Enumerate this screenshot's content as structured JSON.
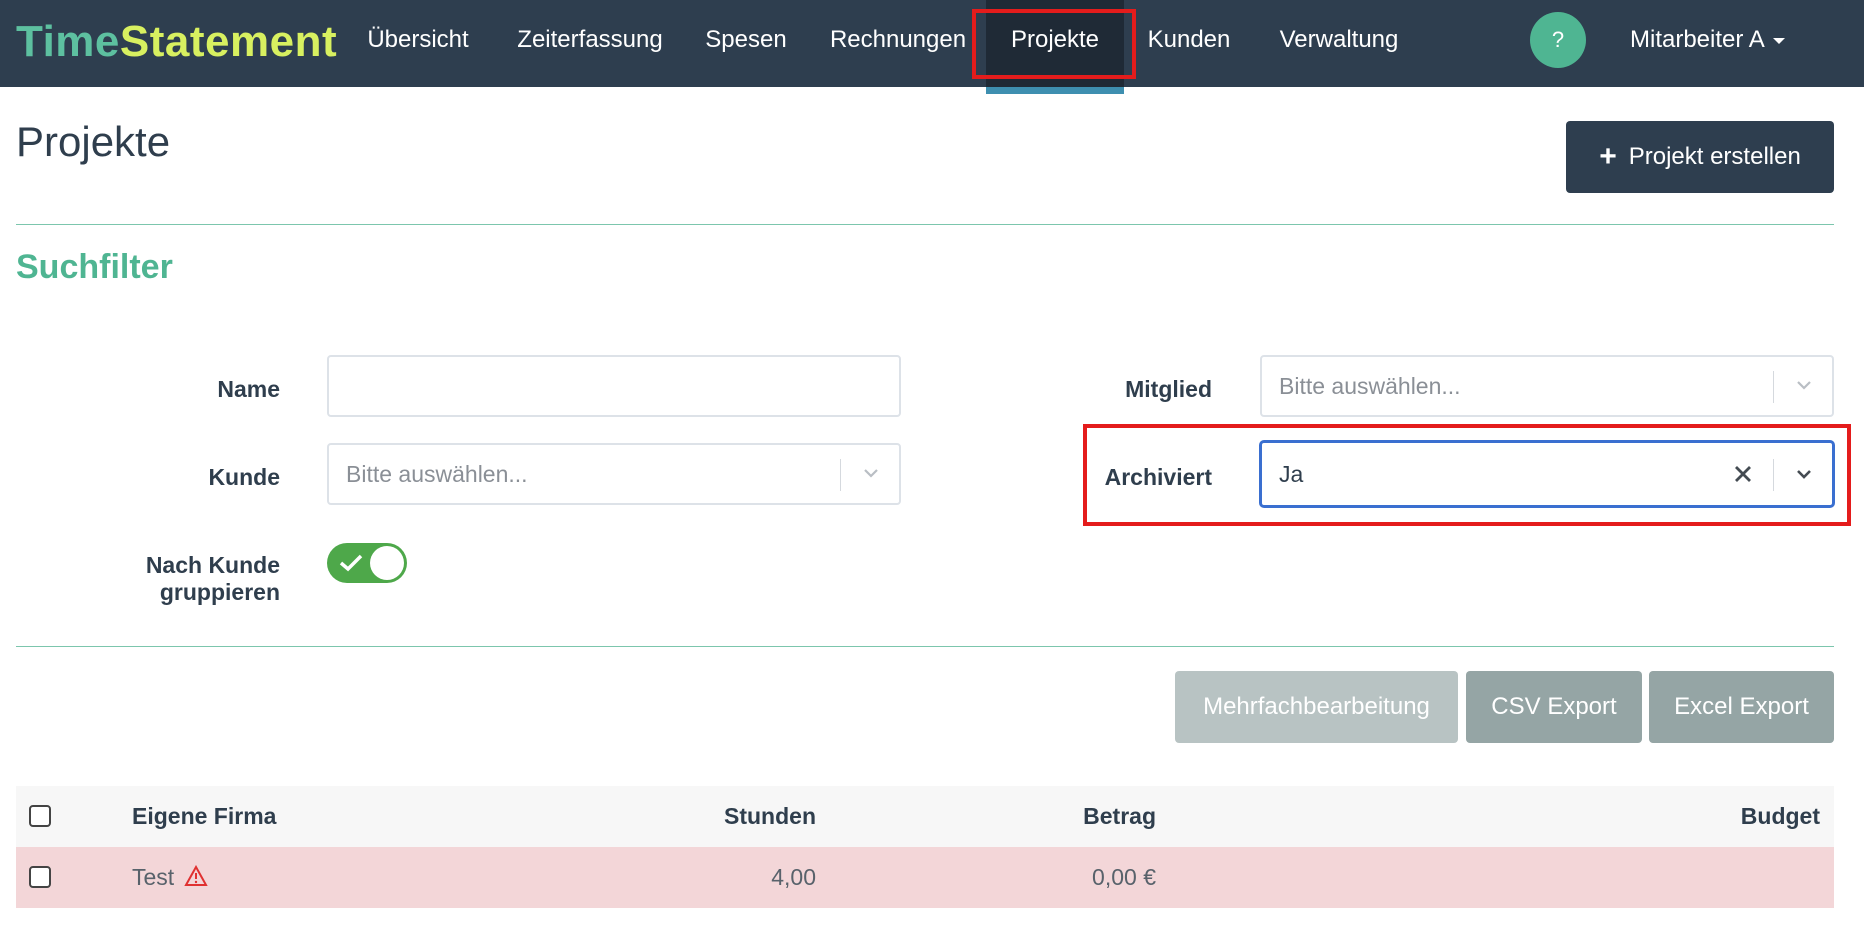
{
  "brand": {
    "part1": "Time",
    "part2": "Statement"
  },
  "nav": {
    "items": [
      {
        "label": "Übersicht"
      },
      {
        "label": "Zeiterfassung"
      },
      {
        "label": "Spesen"
      },
      {
        "label": "Rechnungen"
      },
      {
        "label": "Projekte",
        "active": true
      },
      {
        "label": "Kunden"
      },
      {
        "label": "Verwaltung"
      }
    ],
    "help_label": "?",
    "user_label": "Mitarbeiter A"
  },
  "header": {
    "title": "Projekte",
    "create_button_label": "Projekt erstellen"
  },
  "filters": {
    "title": "Suchfilter",
    "name_label": "Name",
    "name_value": "",
    "kunde_label": "Kunde",
    "kunde_placeholder": "Bitte auswählen...",
    "mitglied_label": "Mitglied",
    "mitglied_placeholder": "Bitte auswählen...",
    "archiviert_label": "Archiviert",
    "archiviert_value": "Ja",
    "group_by_customer_label": "Nach Kunde gruppieren",
    "group_by_customer_enabled": true
  },
  "actions": {
    "multi_edit_label": "Mehrfachbearbeitung",
    "csv_export_label": "CSV Export",
    "excel_export_label": "Excel Export"
  },
  "table": {
    "columns": [
      "Eigene Firma",
      "Stunden",
      "Betrag",
      "Budget"
    ],
    "rows": [
      {
        "name": "Test",
        "stunden": "4,00",
        "betrag": "0,00 €",
        "budget": "",
        "warning": true
      }
    ]
  },
  "colors": {
    "navbar": "#2e3e4f",
    "accent": "#4fb592",
    "highlight": "#e41c1c",
    "row_warning": "#f3d6d8",
    "toggle_on": "#4ea84a"
  }
}
